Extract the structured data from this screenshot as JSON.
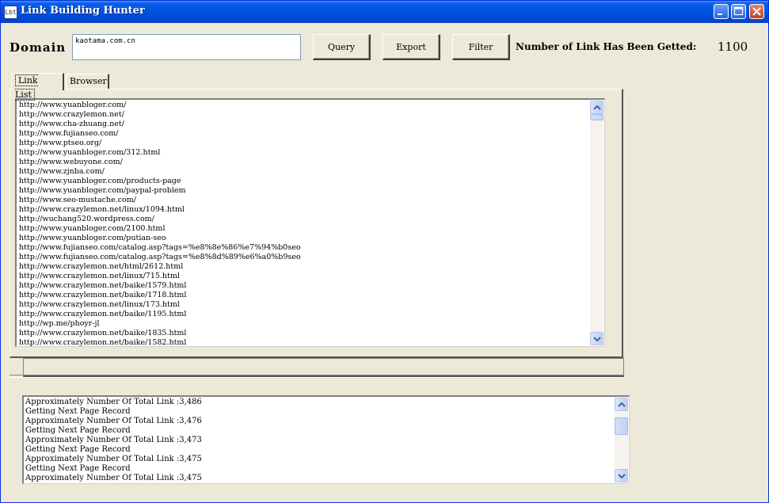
{
  "window": {
    "title": "Link Building Hunter",
    "icon_text": "Lbt"
  },
  "toolbar": {
    "domain_label": "Domain",
    "domain_value": "kaotama.com.cn",
    "query_label": "Query",
    "export_label": "Export",
    "filter_label": "Filter",
    "count_label": "Number of Link Has Been Getted:",
    "count_value": "1100"
  },
  "tabs": [
    {
      "label": "Link List",
      "active": true
    },
    {
      "label": "Browser",
      "active": false
    }
  ],
  "links": [
    "http://www.yuanbloger.com/",
    "http://www.crazylemon.net/",
    "http://www.cha-zhuang.net/",
    "http://www.fujianseo.com/",
    "http://www.ptseo.org/",
    "http://www.yuanbloger.com/312.html",
    "http://www.webuyone.com/",
    "http://www.zjnba.com/",
    "http://www.yuanbloger.com/products-page",
    "http://www.yuanbloger.com/paypal-problem",
    "http://www.seo-mustache.com/",
    "http://www.crazylemon.net/linux/1094.html",
    "http://wuchang520.wordpress.com/",
    "http://www.yuanbloger.com/2100.html",
    "http://www.yuanbloger.com/putian-seo",
    "http://www.fujianseo.com/catalog.asp?tags=%e8%8e%86%e7%94%b0seo",
    "http://www.fujianseo.com/catalog.asp?tags=%e8%8d%89%e6%a0%b9seo",
    "http://www.crazylemon.net/html/2612.html",
    "http://www.crazylemon.net/linux/715.html",
    "http://www.crazylemon.net/baike/1579.html",
    "http://www.crazylemon.net/baike/1718.html",
    "http://www.crazylemon.net/linux/173.html",
    "http://www.crazylemon.net/baike/1195.html",
    "http://wp.me/phoyr-jl",
    "http://www.crazylemon.net/baike/1835.html",
    "http://www.crazylemon.net/baike/1582.html"
  ],
  "log": [
    "Approximately Number Of Total Link :3,486",
    "Getting Next Page Record",
    "Approximately Number Of Total Link :3,476",
    "Getting Next Page Record",
    "Approximately Number Of Total Link :3,473",
    "Getting Next Page Record",
    "Approximately Number Of Total Link :3,475",
    "Getting Next Page Record",
    "Approximately Number Of Total Link :3,475"
  ],
  "icons": {
    "minimize": "minimize-icon",
    "maximize": "maximize-icon",
    "close": "close-icon",
    "scroll_up": "arrow-up-icon",
    "scroll_down": "arrow-down-icon"
  },
  "colors": {
    "titlebar": "#0054e3",
    "window_bg": "#ece9d8",
    "close_button": "#c7401e"
  }
}
